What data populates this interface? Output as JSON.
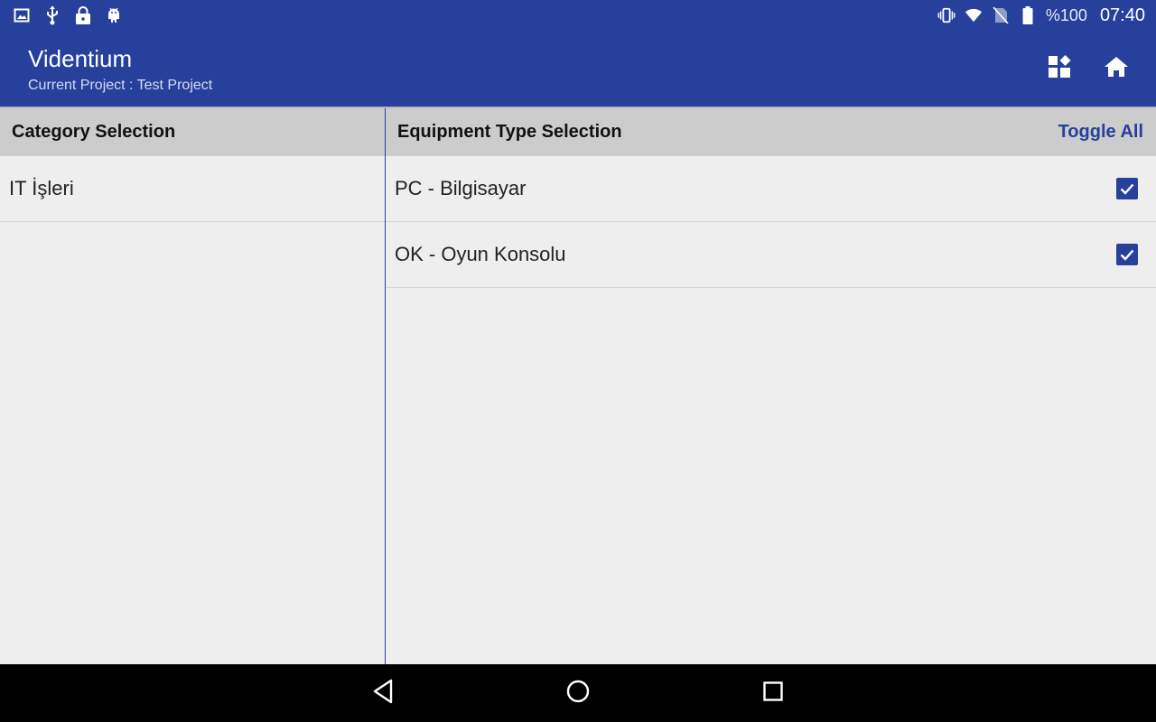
{
  "statusbar": {
    "left_icons": [
      "image-icon",
      "usb-icon",
      "lock-icon",
      "android-icon"
    ],
    "right_icons": [
      "vibrate-icon",
      "wifi-icon",
      "no-sim-icon",
      "battery-icon"
    ],
    "battery": "%100",
    "clock": "07:40"
  },
  "appbar": {
    "title": "Videntium",
    "subtitle": "Current Project : Test Project",
    "actions": [
      "dashboard-icon",
      "home-icon"
    ]
  },
  "category_pane": {
    "header": "Category Selection",
    "items": [
      {
        "label": "IT İşleri"
      }
    ]
  },
  "equipment_pane": {
    "header": "Equipment Type Selection",
    "toggle_all": "Toggle All",
    "items": [
      {
        "label": "PC - Bilgisayar",
        "checked": true
      },
      {
        "label": "OK - Oyun Konsolu",
        "checked": true
      }
    ]
  },
  "navbar": {
    "buttons": [
      "back-icon",
      "home-circle-icon",
      "recents-icon"
    ]
  },
  "colors": {
    "primary": "#27409c",
    "header_bg": "#cccccc",
    "pane_bg": "#eeeeee"
  }
}
